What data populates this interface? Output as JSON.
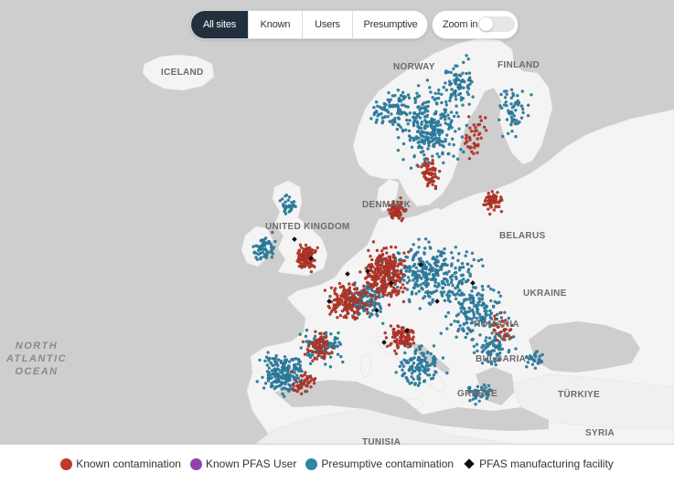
{
  "tabs": [
    {
      "label": "All sites",
      "active": true
    },
    {
      "label": "Known",
      "active": false
    },
    {
      "label": "Users",
      "active": false
    },
    {
      "label": "Presumptive",
      "active": false
    }
  ],
  "zoom": {
    "label": "Zoom in",
    "enabled": false
  },
  "map_labels": {
    "iceland": "ICELAND",
    "norway": "NORWAY",
    "finland": "FINLAND",
    "denmark": "DENMARK",
    "united_kingdom": "UNITED KINGDOM",
    "belarus": "BELARUS",
    "ukraine": "UKRAINE",
    "romania": "ROMANIA",
    "bulgaria": "BULGARIA",
    "greece": "GREECE",
    "turkiye": "TÜRKIYE",
    "tunisia": "TUNISIA",
    "syria": "SYRIA",
    "ocean_line1": "NORTH",
    "ocean_line2": "ATLANTIC",
    "ocean_line3": "OCEAN"
  },
  "legend": [
    {
      "label": "Known contamination",
      "color": "#c0392b",
      "shape": "circle"
    },
    {
      "label": "Known PFAS User",
      "color": "#8e44ad",
      "shape": "circle"
    },
    {
      "label": "Presumptive contamination",
      "color": "#2e86ab",
      "shape": "circle"
    },
    {
      "label": "PFAS manufacturing facility",
      "color": "#111111",
      "shape": "diamond"
    }
  ],
  "colors": {
    "known": "#c0392b",
    "presumptive": "#2e86ab",
    "land": "#f3f3f3",
    "sea": "#cfcfcf",
    "user": "#8e44ad"
  }
}
